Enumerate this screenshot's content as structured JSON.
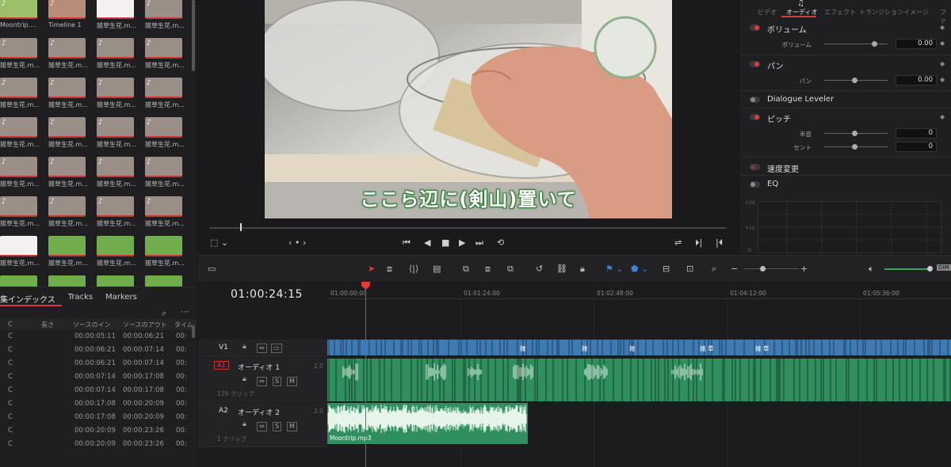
{
  "media_pool": {
    "items": [
      {
        "label": "Moontrip.mp3",
        "kind": "audio"
      },
      {
        "label": "Timeline 1",
        "kind": "timeline"
      },
      {
        "label": "雑草生花.m...",
        "kind": "title"
      },
      {
        "label": "雑草生花.m...",
        "kind": "video"
      },
      {
        "label": "雑草生花.m...",
        "kind": "video"
      },
      {
        "label": "雑草生花.m...",
        "kind": "video"
      },
      {
        "label": "雑草生花.m...",
        "kind": "video"
      },
      {
        "label": "雑草生花.m...",
        "kind": "video"
      },
      {
        "label": "雑草生花.m...",
        "kind": "video"
      },
      {
        "label": "雑草生花.m...",
        "kind": "video"
      },
      {
        "label": "雑草生花.m...",
        "kind": "video"
      },
      {
        "label": "雑草生花.m...",
        "kind": "video"
      },
      {
        "label": "雑草生花.m...",
        "kind": "video"
      },
      {
        "label": "雑草生花.m...",
        "kind": "video"
      },
      {
        "label": "雑草生花.m...",
        "kind": "video"
      },
      {
        "label": "雑草生花.m...",
        "kind": "video"
      },
      {
        "label": "雑草生花.m...",
        "kind": "video"
      },
      {
        "label": "雑草生花.m...",
        "kind": "video"
      },
      {
        "label": "雑草生花.m...",
        "kind": "video"
      },
      {
        "label": "雑草生花.m...",
        "kind": "video"
      },
      {
        "label": "雑草生花.m...",
        "kind": "video"
      },
      {
        "label": "雑草生花.m...",
        "kind": "video"
      },
      {
        "label": "雑草生花.m...",
        "kind": "video"
      },
      {
        "label": "雑草生花.m...",
        "kind": "video"
      },
      {
        "label": "雑草生花.m...",
        "kind": "title"
      },
      {
        "label": "雑草生花.m...",
        "kind": "grass"
      },
      {
        "label": "雑草生花.m...",
        "kind": "grass"
      },
      {
        "label": "雑草生花.m...",
        "kind": "grass"
      },
      {
        "label": "雑草生花.m...",
        "kind": "grass"
      },
      {
        "label": "雑草生花.m...",
        "kind": "grass"
      },
      {
        "label": "雑草生花.m...",
        "kind": "grass"
      },
      {
        "label": "雑草生花.m...",
        "kind": "grass"
      },
      {
        "label": "",
        "kind": "grass"
      },
      {
        "label": "",
        "kind": "grass"
      },
      {
        "label": "",
        "kind": "grass"
      },
      {
        "label": "",
        "kind": "grass"
      }
    ]
  },
  "edit_index": {
    "tabs": [
      "集インデックス",
      "Tracks",
      "Markers"
    ],
    "columns": [
      "C",
      "長さ",
      "ソースのイン",
      "ソースのアウト",
      "タイムラ"
    ],
    "rows": [
      [
        "C",
        "00:00:05:11",
        "00:00:06:21",
        "00:"
      ],
      [
        "C",
        "00:00:06:21",
        "00:00:07:14",
        "00:"
      ],
      [
        "C",
        "00:00:06:21",
        "00:00:07:14",
        "00:"
      ],
      [
        "C",
        "00:00:07:14",
        "00:00:17:08",
        "00:"
      ],
      [
        "C",
        "00:00:07:14",
        "00:00:17:08",
        "00:"
      ],
      [
        "C",
        "00:00:17:08",
        "00:00:20:09",
        "00:"
      ],
      [
        "C",
        "00:00:17:08",
        "00:00:20:09",
        "00:"
      ],
      [
        "C",
        "00:00:20:09",
        "00:00:23:26",
        "00:"
      ],
      [
        "C",
        "00:00:20:09",
        "00:00:23:26",
        "00:"
      ]
    ]
  },
  "viewer": {
    "subtitle": "ここら辺に(剣山)置いて"
  },
  "inspector": {
    "tabs": [
      "ビデオ",
      "オーディオ",
      "エフェクト",
      "トランジション",
      "イメージ",
      "ファ"
    ],
    "volume": {
      "title": "ボリューム",
      "param": "ボリューム",
      "value": "0.00"
    },
    "pan": {
      "title": "パン",
      "param": "パン",
      "value": "0.00"
    },
    "dialogue": {
      "title": "Dialogue Leveler"
    },
    "pitch": {
      "title": "ピッチ",
      "semitone": "半音",
      "semitone_value": "0",
      "cent": "セント",
      "cent_value": "0"
    },
    "speed": {
      "title": "速度変更"
    },
    "eq": {
      "title": "EQ",
      "labels": [
        "+24",
        "+12",
        "0"
      ]
    }
  },
  "timeline": {
    "timecode": "01:00:24:15",
    "ruler": [
      "01:00:00:00",
      "01:01:24:00",
      "01:02:48:00",
      "01:04:12:00",
      "01:05:36:00"
    ],
    "v1": {
      "name": "V1",
      "clip_labels": [
        "雑",
        "雑",
        "雑",
        "雑 草",
        "雑 草"
      ]
    },
    "a1": {
      "badge": "A1",
      "name": "オーディオ 1",
      "level": "2.0",
      "clips": "129 クリップ",
      "s": "S",
      "m": "M"
    },
    "a2": {
      "name": "A2",
      "title": "オーディオ 2",
      "level": "2.0",
      "clips": "1 クリップ",
      "s": "S",
      "m": "M",
      "clip_label": "Moontrip.mp3"
    },
    "dim_label": "DIM"
  },
  "colors": {
    "accent_red": "#e23b3b",
    "video_clip": "#3f7ab3",
    "audio_clip": "#2f8f5e",
    "subtitle_outline": "#2e7d32"
  }
}
